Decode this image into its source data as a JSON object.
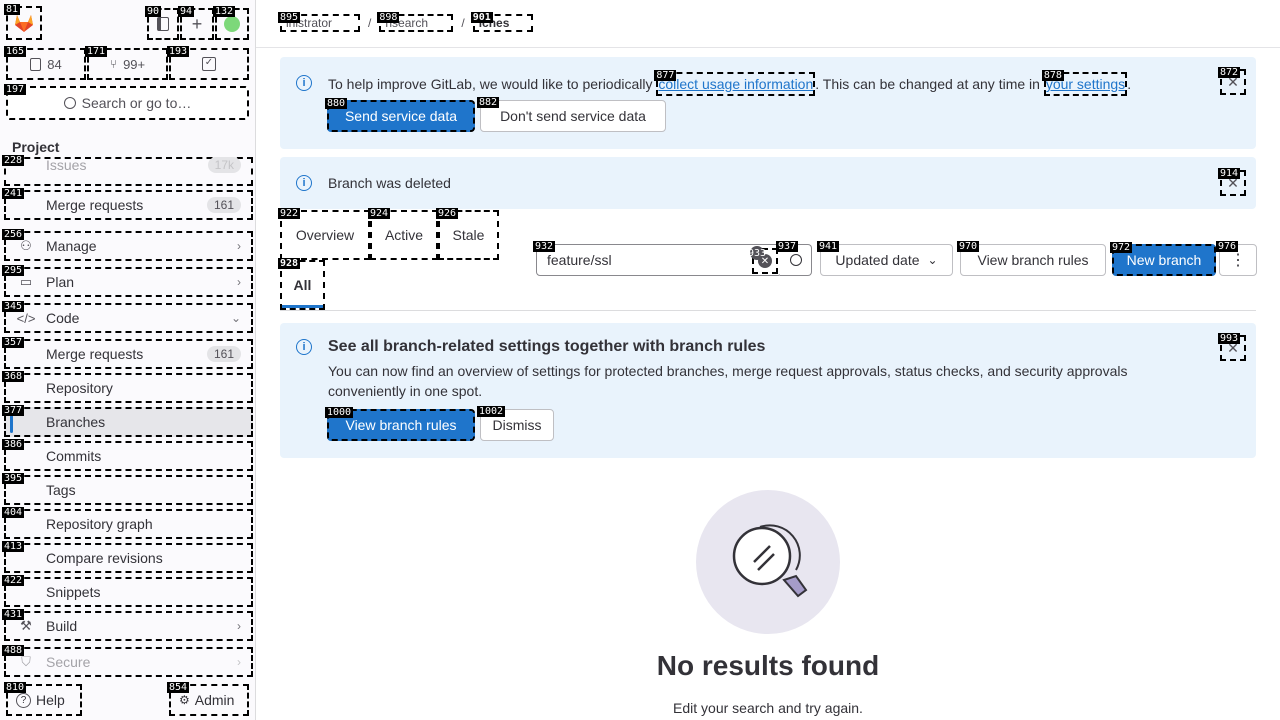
{
  "sidebar": {
    "tags": {
      "logo": "81",
      "sidebar_toggle": "90",
      "create_new": "94",
      "user_menu": "132",
      "issues_counter": "165",
      "mr_counter": "171",
      "todos_counter": "193",
      "search": "197",
      "issues": "228",
      "merge_requests": "241",
      "manage": "256",
      "plan": "295",
      "code": "345",
      "code_merge_requests": "357",
      "repository": "368",
      "branches": "377",
      "commits": "386",
      "tags_item": "395",
      "repository_graph": "404",
      "compare_revisions": "413",
      "snippets": "422",
      "build": "431",
      "secure": "488",
      "help": "810",
      "admin": "854"
    },
    "counters": {
      "issues": "84",
      "merge_requests": "99+"
    },
    "search_label": "Search or go to…",
    "section_title": "Project",
    "items": {
      "issues": {
        "label": "Issues",
        "badge": "17k"
      },
      "merge_requests": {
        "label": "Merge requests",
        "badge": "161"
      },
      "manage": {
        "label": "Manage"
      },
      "plan": {
        "label": "Plan"
      },
      "code": {
        "label": "Code"
      },
      "code_merge_requests": {
        "label": "Merge requests",
        "badge": "161"
      },
      "repository": {
        "label": "Repository"
      },
      "branches": {
        "label": "Branches"
      },
      "commits": {
        "label": "Commits"
      },
      "tags": {
        "label": "Tags"
      },
      "repository_graph": {
        "label": "Repository graph"
      },
      "compare_revisions": {
        "label": "Compare revisions"
      },
      "snippets": {
        "label": "Snippets"
      },
      "build": {
        "label": "Build"
      },
      "secure": {
        "label": "Secure"
      }
    },
    "help_label": "Help",
    "admin_label": "Admin"
  },
  "breadcrumb": {
    "tags": {
      "c1": "895",
      "c2": "898",
      "c3": "901"
    },
    "items": [
      "inistrator",
      "nsearch",
      "iches"
    ],
    "separator": "/"
  },
  "usage_alert": {
    "tags": {
      "link1": "877",
      "link2": "878",
      "close": "872",
      "send": "880",
      "dont_send": "882"
    },
    "text_before": "To help improve GitLab, we would like to periodically",
    "link1_text": "collect usage information",
    "text_middle": ". This can be changed at any time in",
    "link2_text": "your settings",
    "text_after": ".",
    "send_label": "Send service data",
    "dont_send_label": "Don't send service data"
  },
  "deleted_alert": {
    "tags": {
      "close": "914"
    },
    "text": "Branch was deleted"
  },
  "tabs": {
    "tags": {
      "overview": "922",
      "active": "924",
      "stale": "926",
      "all": "928"
    },
    "overview": "Overview",
    "active": "Active",
    "stale": "Stale",
    "all": "All"
  },
  "filter": {
    "tags": {
      "input": "932",
      "clear": "933",
      "search": "937",
      "sort": "941",
      "view_rules": "970",
      "new_branch": "972",
      "more": "976"
    },
    "value": "feature/ssl",
    "sort_label": "Updated date",
    "view_rules_label": "View branch rules",
    "new_branch_label": "New branch"
  },
  "rules_alert": {
    "tags": {
      "close": "993",
      "view": "1000",
      "dismiss": "1002"
    },
    "title": "See all branch-related settings together with branch rules",
    "body": "You can now find an overview of settings for protected branches, merge request approvals, status checks, and security approvals conveniently in one spot.",
    "view_label": "View branch rules",
    "dismiss_label": "Dismiss"
  },
  "empty_state": {
    "title": "No results found",
    "subtitle": "Edit your search and try again."
  },
  "colors": {
    "accent": "#1f75cb",
    "alert_bg": "#e9f3fc",
    "illustration_bg": "#e8e6f0"
  }
}
